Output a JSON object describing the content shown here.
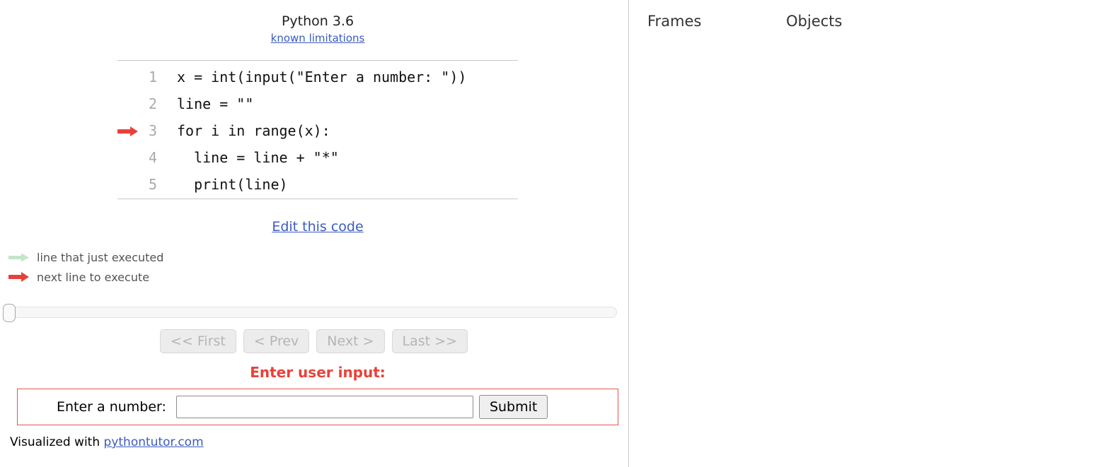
{
  "header": {
    "python_version": "Python 3.6",
    "known_limitations_label": "known limitations"
  },
  "code": {
    "lines": [
      {
        "number": "1",
        "text": "x = int(input(\"Enter a number: \"))",
        "arrow": "next-arrow"
      },
      {
        "number": "2",
        "text": "line = \"\"",
        "arrow": "none"
      },
      {
        "number": "3",
        "text": "for i in range(x):",
        "arrow": "none"
      },
      {
        "number": "4",
        "text": "  line = line + \"*\"",
        "arrow": "none"
      },
      {
        "number": "5",
        "text": "  print(line)",
        "arrow": "none"
      }
    ],
    "edit_link_label": "Edit this code"
  },
  "legend": {
    "items": [
      {
        "icon": "green-arrow-icon",
        "label": "line that just executed",
        "color": "#c3e6c8"
      },
      {
        "icon": "red-arrow-icon",
        "label": "next line to execute",
        "color": "#e8413a"
      }
    ]
  },
  "slider": {
    "position_percent": 0
  },
  "navigation": {
    "buttons": [
      {
        "label": "<< First",
        "disabled": true
      },
      {
        "label": "< Prev",
        "disabled": true
      },
      {
        "label": "Next >",
        "disabled": true
      },
      {
        "label": "Last >>",
        "disabled": true
      }
    ]
  },
  "user_input": {
    "heading": "Enter user input:",
    "prompt_label": "Enter a number:",
    "field_value": "",
    "field_placeholder": "",
    "submit_label": "Submit"
  },
  "footer": {
    "prefix": "Visualized with ",
    "link_label": "pythontutor.com"
  },
  "right_pane": {
    "frames_label": "Frames",
    "objects_label": "Objects"
  },
  "colors": {
    "link": "#3b5bc0",
    "alert_red": "#e8413a",
    "executed_green": "#c3e6c8",
    "line_number_grey": "#aaaaaa"
  }
}
